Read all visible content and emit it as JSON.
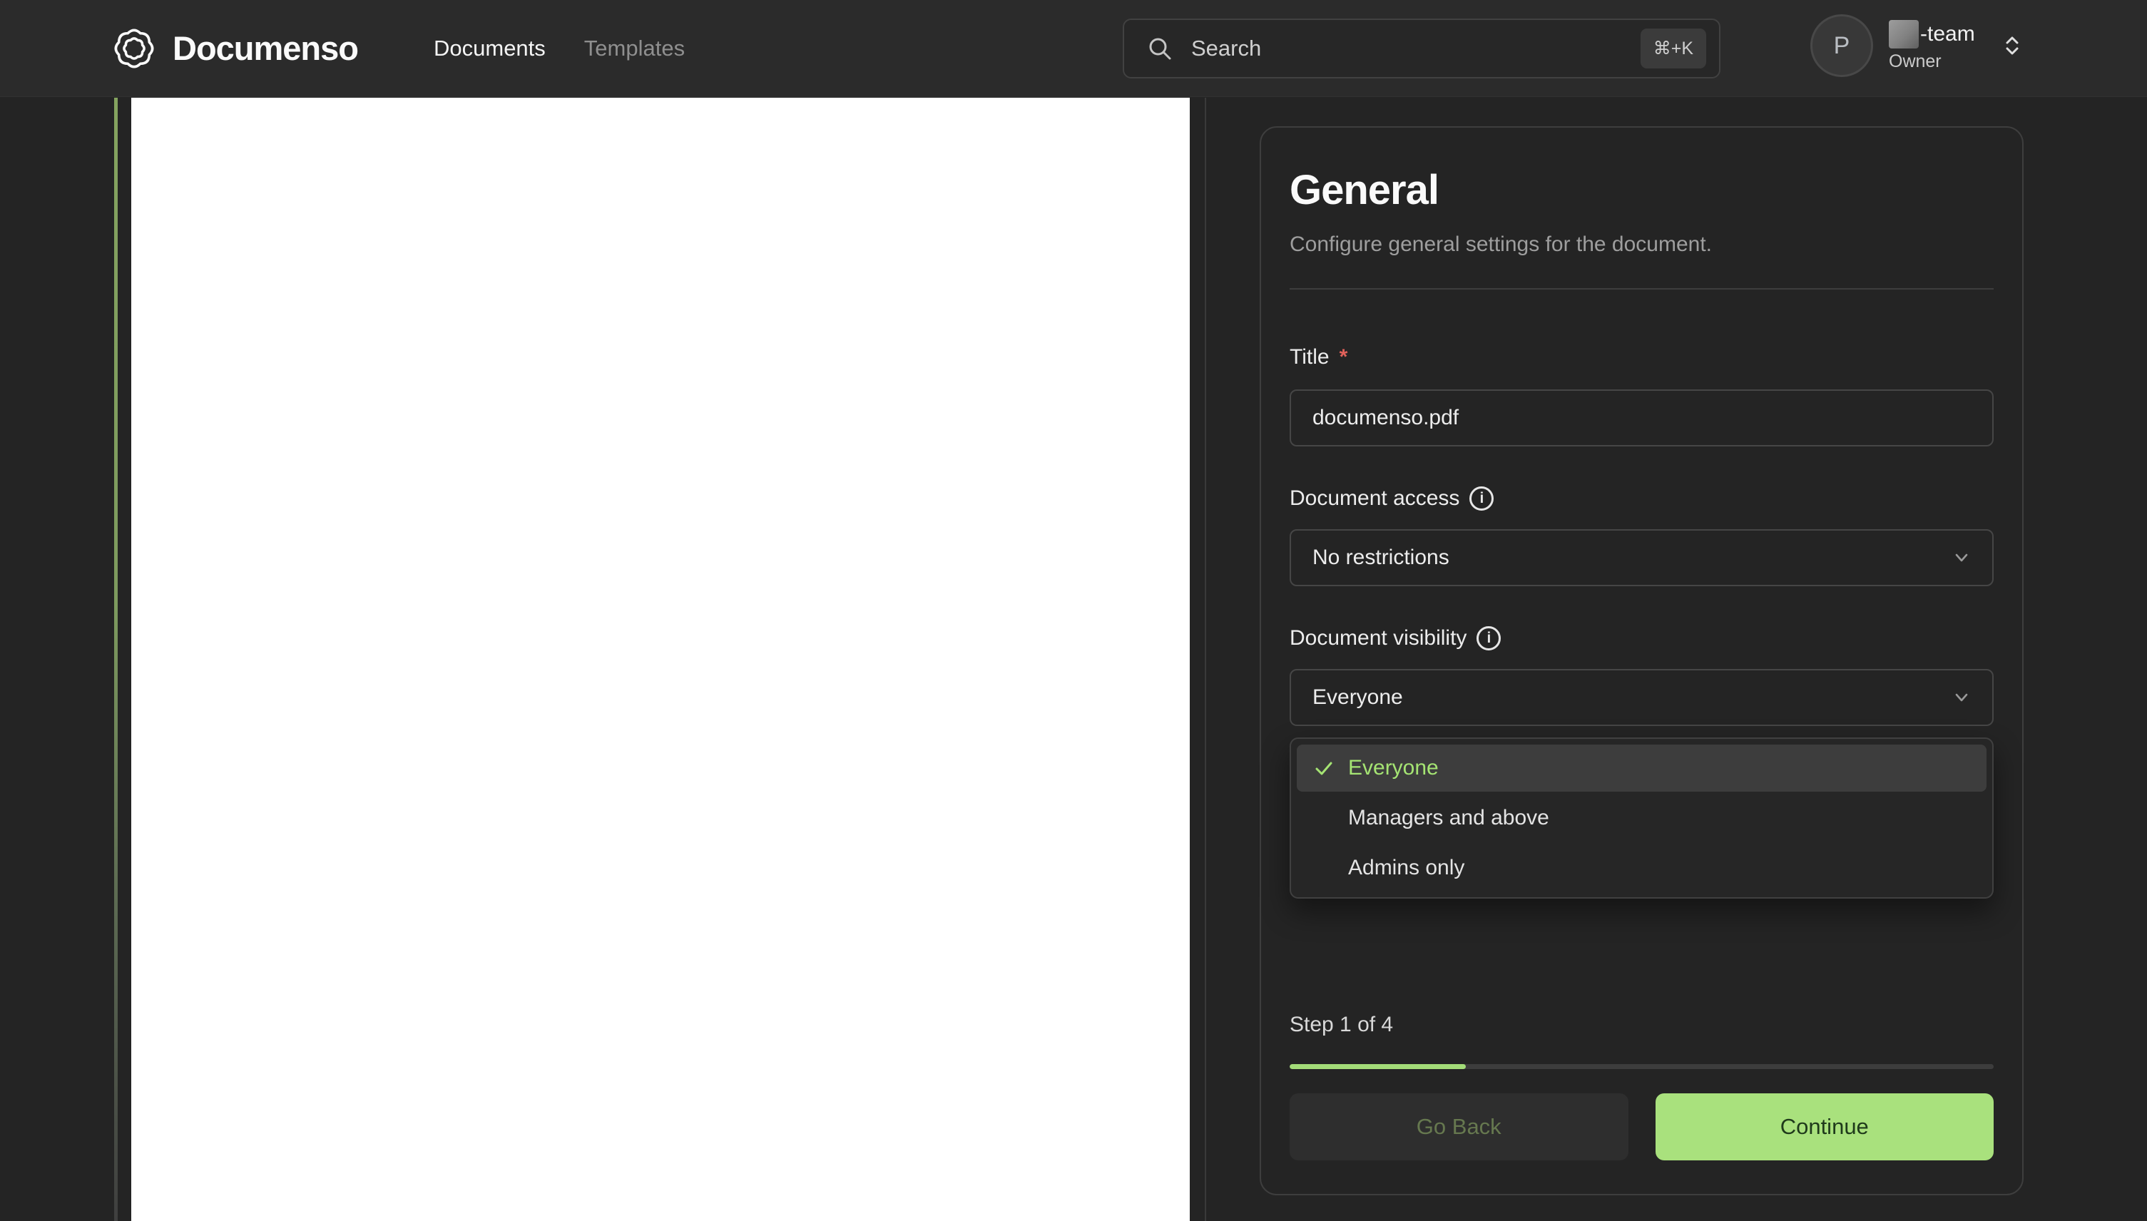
{
  "navbar": {
    "brand": "Documenso",
    "nav_items": [
      {
        "label": "Documents",
        "active": true
      },
      {
        "label": "Templates",
        "active": false
      }
    ],
    "search": {
      "placeholder": "Search",
      "shortcut": "⌘+K"
    },
    "user": {
      "avatar_initial": "P",
      "team_suffix": "-team",
      "role": "Owner"
    }
  },
  "panel": {
    "title": "General",
    "subtitle": "Configure general settings for the document.",
    "fields": {
      "title": {
        "label": "Title",
        "required_marker": "*",
        "value": "documenso.pdf"
      },
      "access": {
        "label": "Document access",
        "value": "No restrictions"
      },
      "visibility": {
        "label": "Document visibility",
        "value": "Everyone"
      }
    },
    "visibility_dropdown": {
      "options": [
        {
          "label": "Everyone",
          "selected": true
        },
        {
          "label": "Managers and above",
          "selected": false
        },
        {
          "label": "Admins only",
          "selected": false
        }
      ]
    },
    "step": {
      "text": "Step 1 of 4",
      "progress_percent": 25
    },
    "buttons": {
      "back": "Go Back",
      "continue": "Continue"
    }
  },
  "icons": {
    "logo": "rosette-seal",
    "search": "magnifier",
    "team_switcher": "chevrons-up-down",
    "info": "circle-i",
    "select": "chevron-down",
    "selected_option": "checkmark"
  },
  "colors": {
    "accent_green": "#a2e771",
    "progress_fill": "#a3dc78",
    "continue_bg": "#a9e17d",
    "continue_text": "#1f3a1b",
    "selected_option_text": "#a5e473",
    "required_star": "#e0615a",
    "navbar_bg": "#2b2b2b",
    "page_bg": "#242424",
    "document_bg": "#ffffff"
  }
}
